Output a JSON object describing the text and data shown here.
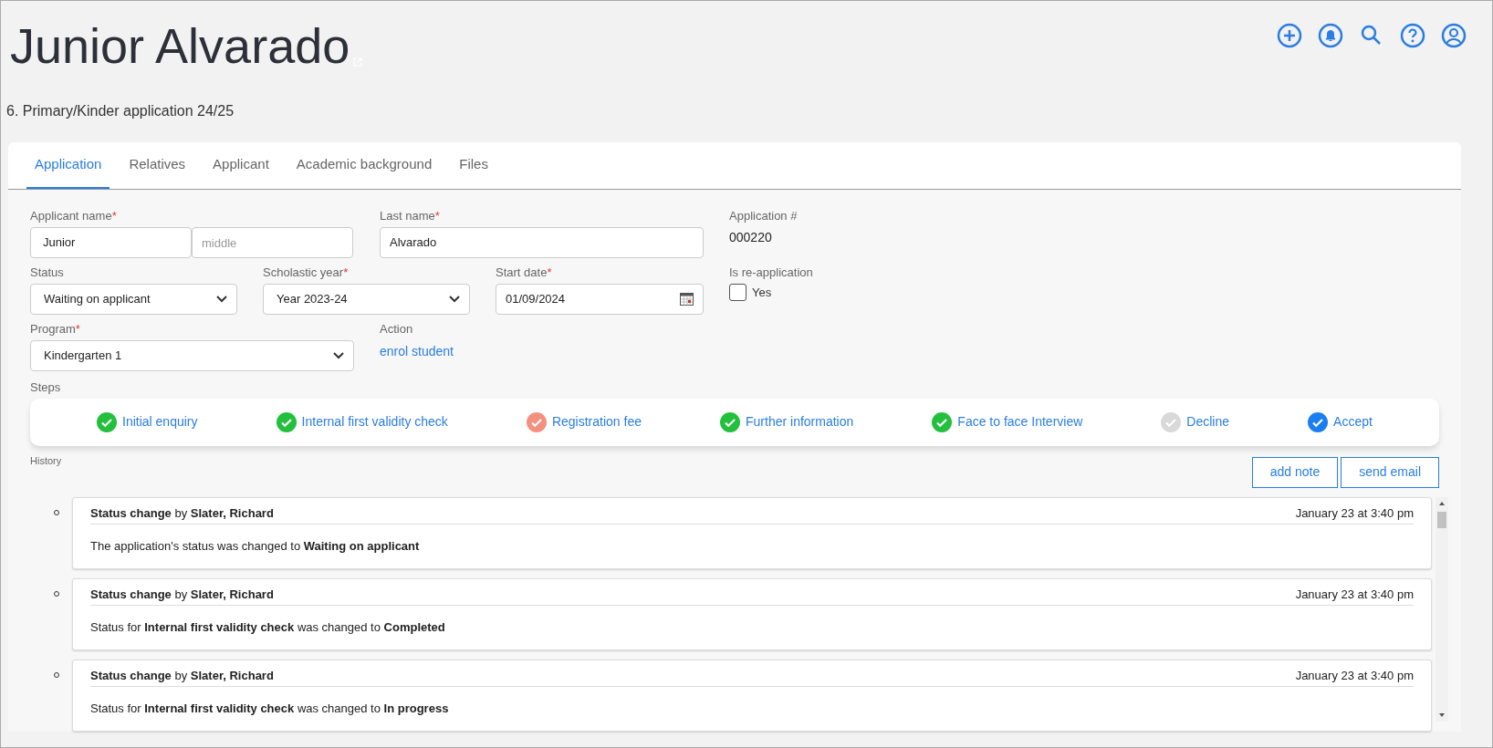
{
  "header": {
    "title": "Junior Alvarado",
    "subtitle": "6. Primary/Kinder application 24/25"
  },
  "tabs": [
    {
      "label": "Application",
      "selected": true
    },
    {
      "label": "Relatives",
      "selected": false
    },
    {
      "label": "Applicant",
      "selected": false
    },
    {
      "label": "Academic background",
      "selected": false
    },
    {
      "label": "Files",
      "selected": false
    }
  ],
  "form": {
    "applicant_name": {
      "label": "Applicant name",
      "required_mark": "*",
      "first": "Junior",
      "middle_placeholder": "middle"
    },
    "last_name": {
      "label": "Last name",
      "required_mark": "*",
      "value": "Alvarado"
    },
    "application_number": {
      "label": "Application #",
      "value": "000220"
    },
    "status": {
      "label": "Status",
      "value": "Waiting on applicant"
    },
    "scholastic_year": {
      "label": "Scholastic year",
      "required_mark": "*",
      "value": "Year 2023-24"
    },
    "start_date": {
      "label": "Start date",
      "required_mark": "*",
      "value": "01/09/2024"
    },
    "re_application": {
      "label": "Is re-application",
      "option": "Yes",
      "checked": false
    },
    "program": {
      "label": "Program",
      "required_mark": "*",
      "value": "Kindergarten 1"
    },
    "action": {
      "label": "Action",
      "link": "enrol student"
    }
  },
  "steps": {
    "label": "Steps",
    "items": [
      {
        "label": "Initial enquiry",
        "color": "#22c03c"
      },
      {
        "label": "Internal first validity check",
        "color": "#22c03c"
      },
      {
        "label": "Registration fee",
        "color": "#f4907e"
      },
      {
        "label": "Further information",
        "color": "#22c03c"
      },
      {
        "label": "Face to face Interview",
        "color": "#22c03c"
      },
      {
        "label": "Decline",
        "color": "#d9d9d9"
      },
      {
        "label": "Accept",
        "color": "#1a7ef0"
      }
    ]
  },
  "history": {
    "label": "History",
    "buttons": [
      "add note",
      "send email"
    ],
    "entries": [
      {
        "title": "**Status change** by **Slater, Richard**",
        "time": "January 23 at 3:40 pm",
        "body": "The application's status was changed to **Waiting on applicant**"
      },
      {
        "title": "**Status change** by **Slater, Richard**",
        "time": "January 23 at 3:40 pm",
        "body": "Status for **Internal first validity check** was changed to **Completed**"
      },
      {
        "title": "**Status change** by **Slater, Richard**",
        "time": "January 23 at 3:40 pm",
        "body": "Status for **Internal first validity check** was changed to **In progress**"
      }
    ]
  }
}
